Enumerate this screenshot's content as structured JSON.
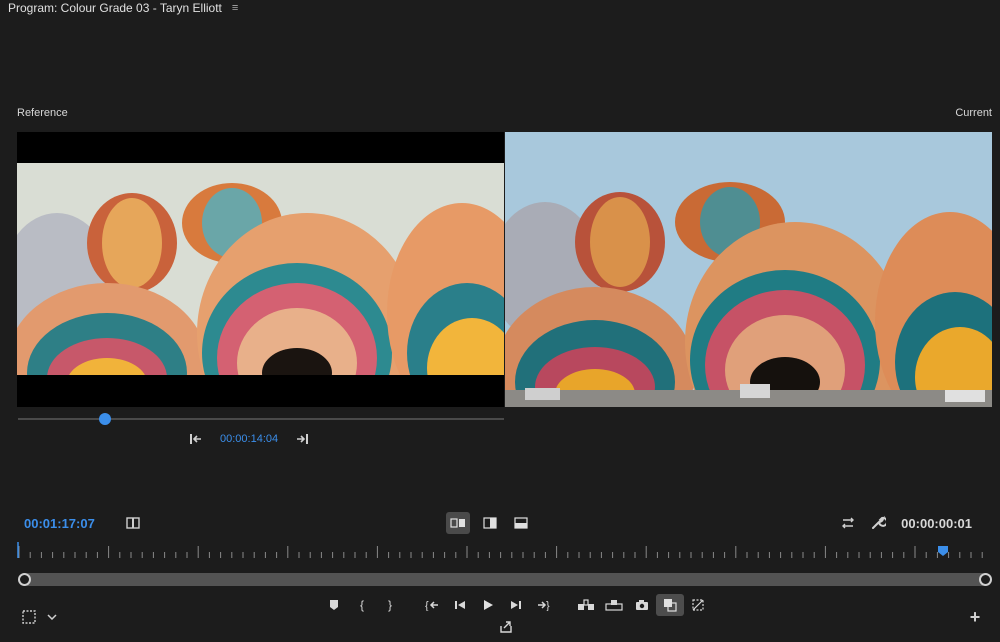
{
  "panel": {
    "title": "Program: Colour Grade 03 - Taryn Elliott",
    "menu_icon": "hamburger-icon"
  },
  "reference": {
    "label": "Reference",
    "timecode": "00:00:14:04",
    "scrub_position": 0.18
  },
  "current": {
    "label": "Current"
  },
  "playhead": {
    "timecode": "00:01:17:07",
    "duration_timecode": "00:00:00:01"
  },
  "view_modes": [
    "side-by-side-icon",
    "split-vertical-icon",
    "split-horizontal-icon"
  ],
  "colors": {
    "accent": "#3b8eea",
    "background": "#1c1c1c",
    "active_button": "#4a4a4a"
  },
  "transport": [
    "marker-icon",
    "mark-in-icon",
    "mark-out-icon",
    "go-to-in-icon",
    "step-back-icon",
    "play-icon",
    "step-forward-icon",
    "go-to-out-icon",
    "insert-icon",
    "overwrite-icon",
    "export-frame-icon",
    "comparison-view-icon",
    "proxy-toggle-icon"
  ]
}
